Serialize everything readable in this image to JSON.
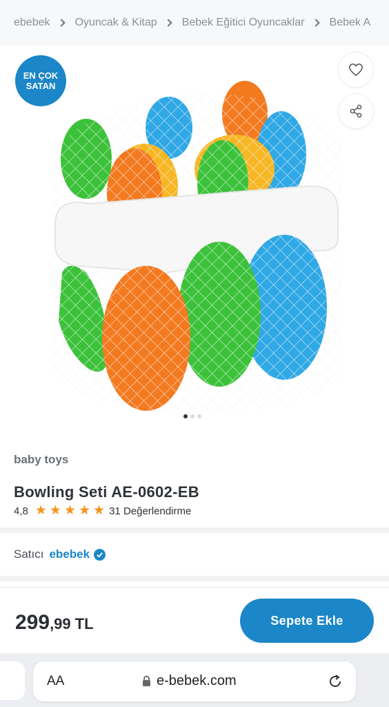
{
  "breadcrumb": [
    "ebebek",
    "Oyuncak & Kitap",
    "Bebek Eğitici Oyuncaklar",
    "Bebek A"
  ],
  "badge": {
    "line1": "EN ÇOK",
    "line2": "SATAN"
  },
  "gallery": {
    "dots": 3,
    "active_dot": 1
  },
  "product": {
    "brand": "baby toys",
    "title": "Bowling Seti AE-0602-EB",
    "rating": "4,8",
    "stars": 5,
    "reviews": "31 Değerlendirme"
  },
  "seller": {
    "label": "Satıcı",
    "name": "ebebek"
  },
  "price": {
    "main": "299",
    "cents": ",99",
    "currency": "TL"
  },
  "cart_button": "Sepete Ekle",
  "browser": {
    "text_size": "AA",
    "url": "e-bebek.com"
  },
  "colors": {
    "accent": "#1b86c8",
    "star": "#f7941d"
  }
}
